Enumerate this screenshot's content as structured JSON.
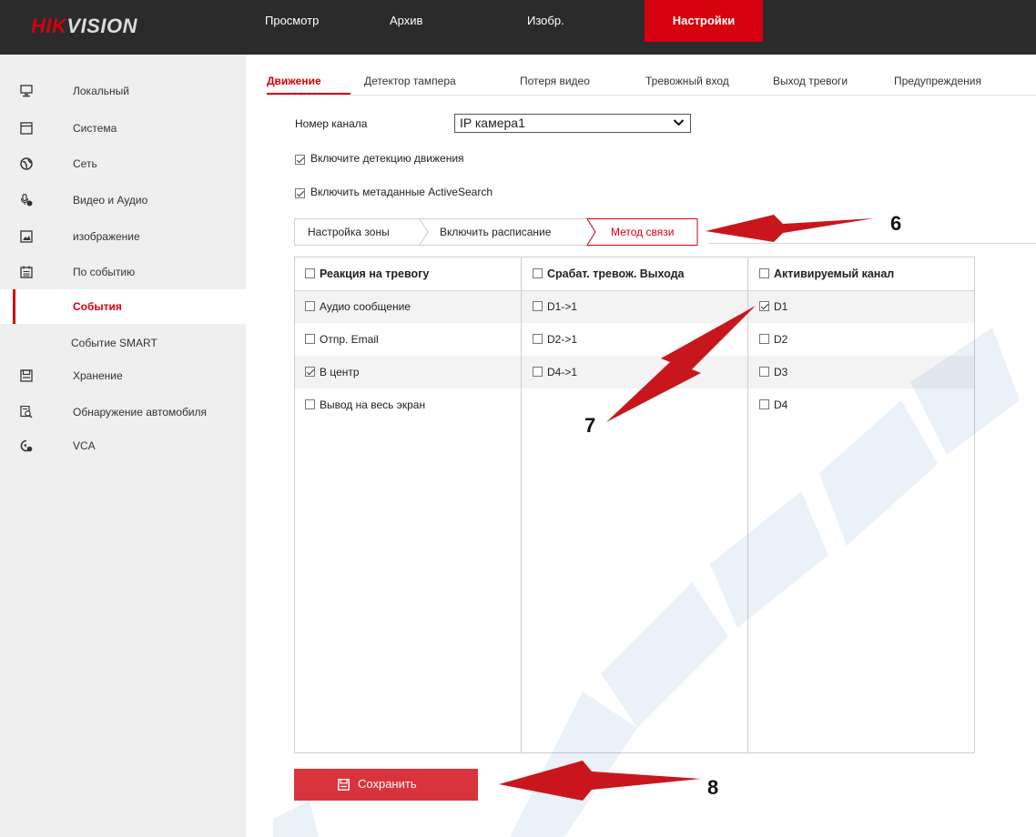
{
  "brand": {
    "logo_hik": "HIK",
    "logo_vision": "VISION"
  },
  "nav": {
    "tabs": [
      {
        "label": "Просмотр"
      },
      {
        "label": "Архив"
      },
      {
        "label": "Изобр."
      },
      {
        "label": "Настройки",
        "active": true
      }
    ]
  },
  "sidebar": {
    "items": [
      {
        "label": "Локальный",
        "icon": "monitor-icon"
      },
      {
        "label": "Система",
        "icon": "system-icon"
      },
      {
        "label": "Сеть",
        "icon": "globe-icon"
      },
      {
        "label": "Видео и Аудио",
        "icon": "microphone-icon"
      },
      {
        "label": "изображение",
        "icon": "image-icon"
      },
      {
        "label": "По событию",
        "icon": "calendar-icon"
      },
      {
        "label": "События",
        "active": true
      },
      {
        "label": "Событие SMART"
      },
      {
        "label": "Хранение",
        "icon": "storage-icon"
      },
      {
        "label": "Обнаружение автомобиля",
        "icon": "vehicle-search-icon"
      },
      {
        "label": "VCA",
        "icon": "vca-icon"
      }
    ]
  },
  "subtabs": [
    {
      "label": "Движение",
      "active": true
    },
    {
      "label": "Детектор тампера"
    },
    {
      "label": "Потеря видео"
    },
    {
      "label": "Тревожный вход"
    },
    {
      "label": "Выход тревоги"
    },
    {
      "label": "Предупреждения"
    }
  ],
  "form": {
    "channel_label": "Номер канала",
    "channel_value": "IP камера1",
    "enable_motion_label": "Включите детекцию движения",
    "enable_motion_checked": true,
    "enable_metadata_label": "Включить метаданные ActiveSearch",
    "enable_metadata_checked": true
  },
  "crumbs": [
    {
      "label": "Настройка зоны"
    },
    {
      "label": "Включить расписание"
    },
    {
      "label": "Метод связи",
      "active": true
    }
  ],
  "linkage_table": {
    "columns": [
      {
        "header": "Реакция на тревогу",
        "items": [
          {
            "label": "Аудио сообщение",
            "checked": false
          },
          {
            "label": "Отпр. Email",
            "checked": false
          },
          {
            "label": "В центр",
            "checked": true
          },
          {
            "label": "Вывод на весь экран",
            "checked": false
          }
        ]
      },
      {
        "header": "Срабат. тревож. Выхода",
        "items": [
          {
            "label": "D1->1",
            "checked": false
          },
          {
            "label": "D2->1",
            "checked": false
          },
          {
            "label": "D4->1",
            "checked": false
          }
        ]
      },
      {
        "header": "Активируемый канал",
        "items": [
          {
            "label": "D1",
            "checked": true
          },
          {
            "label": "D2",
            "checked": false
          },
          {
            "label": "D3",
            "checked": false
          },
          {
            "label": "D4",
            "checked": false
          }
        ]
      }
    ]
  },
  "save": {
    "label": "Сохранить"
  },
  "annotations": {
    "a6": "6",
    "a7": "7",
    "a8": "8"
  },
  "colors": {
    "accent": "#d7000f",
    "topbar": "#2b2b2b",
    "sidebar": "#efefef",
    "button": "#d9343d",
    "watermark": "#1a64b4"
  }
}
